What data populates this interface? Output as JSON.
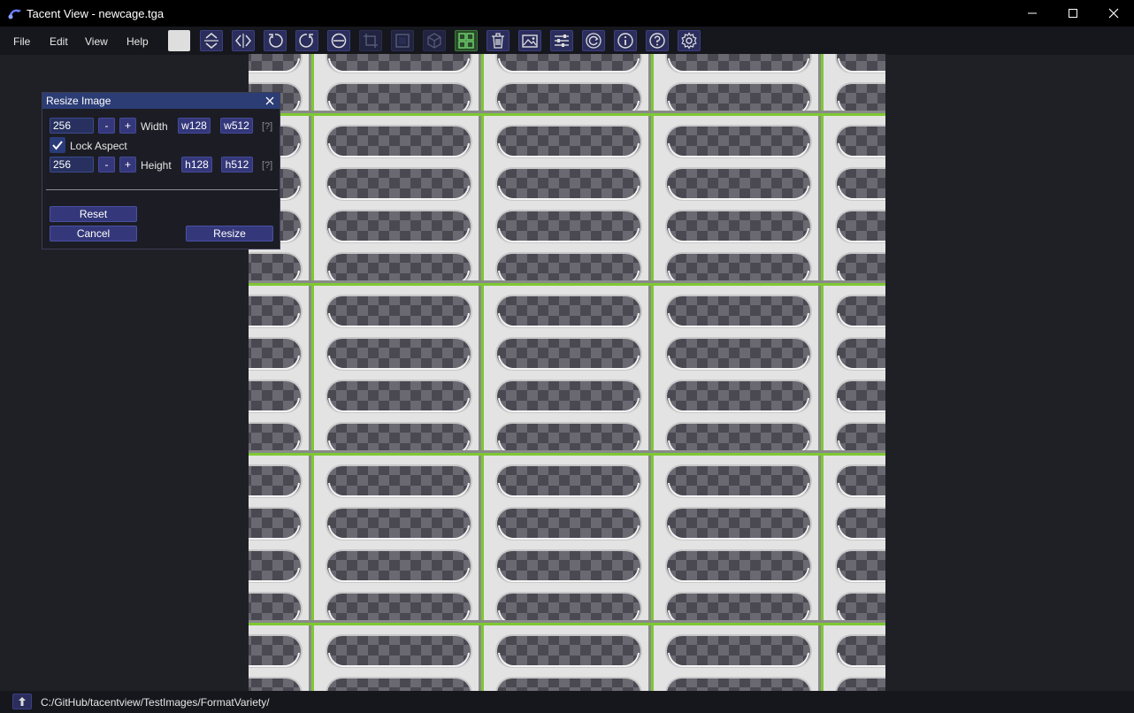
{
  "window": {
    "title": "Tacent View - newcage.tga"
  },
  "menu": {
    "items": [
      "File",
      "Edit",
      "View",
      "Help"
    ]
  },
  "toolbar": {
    "icons": [
      "color-swatch",
      "flip-vertical-icon",
      "flip-horizontal-icon",
      "rotate-ccw-icon",
      "rotate-cw-icon",
      "crop-circle-icon",
      "crop-icon",
      "square-icon",
      "cube-icon",
      "grid-icon",
      "trash-icon",
      "image-icon",
      "sliders-icon",
      "refresh-icon",
      "info-icon",
      "help-icon",
      "settings-icon"
    ]
  },
  "dialog": {
    "title": "Resize Image",
    "width_value": "256",
    "height_value": "256",
    "minus": "-",
    "plus": "+",
    "width_label": "Width",
    "height_label": "Height",
    "w128": "w128",
    "w512": "w512",
    "h128": "h128",
    "h512": "h512",
    "help": "[?]",
    "lock_aspect_label": "Lock Aspect",
    "lock_aspect_checked": true,
    "reset_label": "Reset",
    "cancel_label": "Cancel",
    "resize_label": "Resize"
  },
  "status": {
    "path": "C:/GitHub/tacentview/TestImages/FormatVariety/"
  },
  "colors": {
    "accent": "#2c3d75",
    "button": "#34387a",
    "green_edge": "#7ec832"
  }
}
